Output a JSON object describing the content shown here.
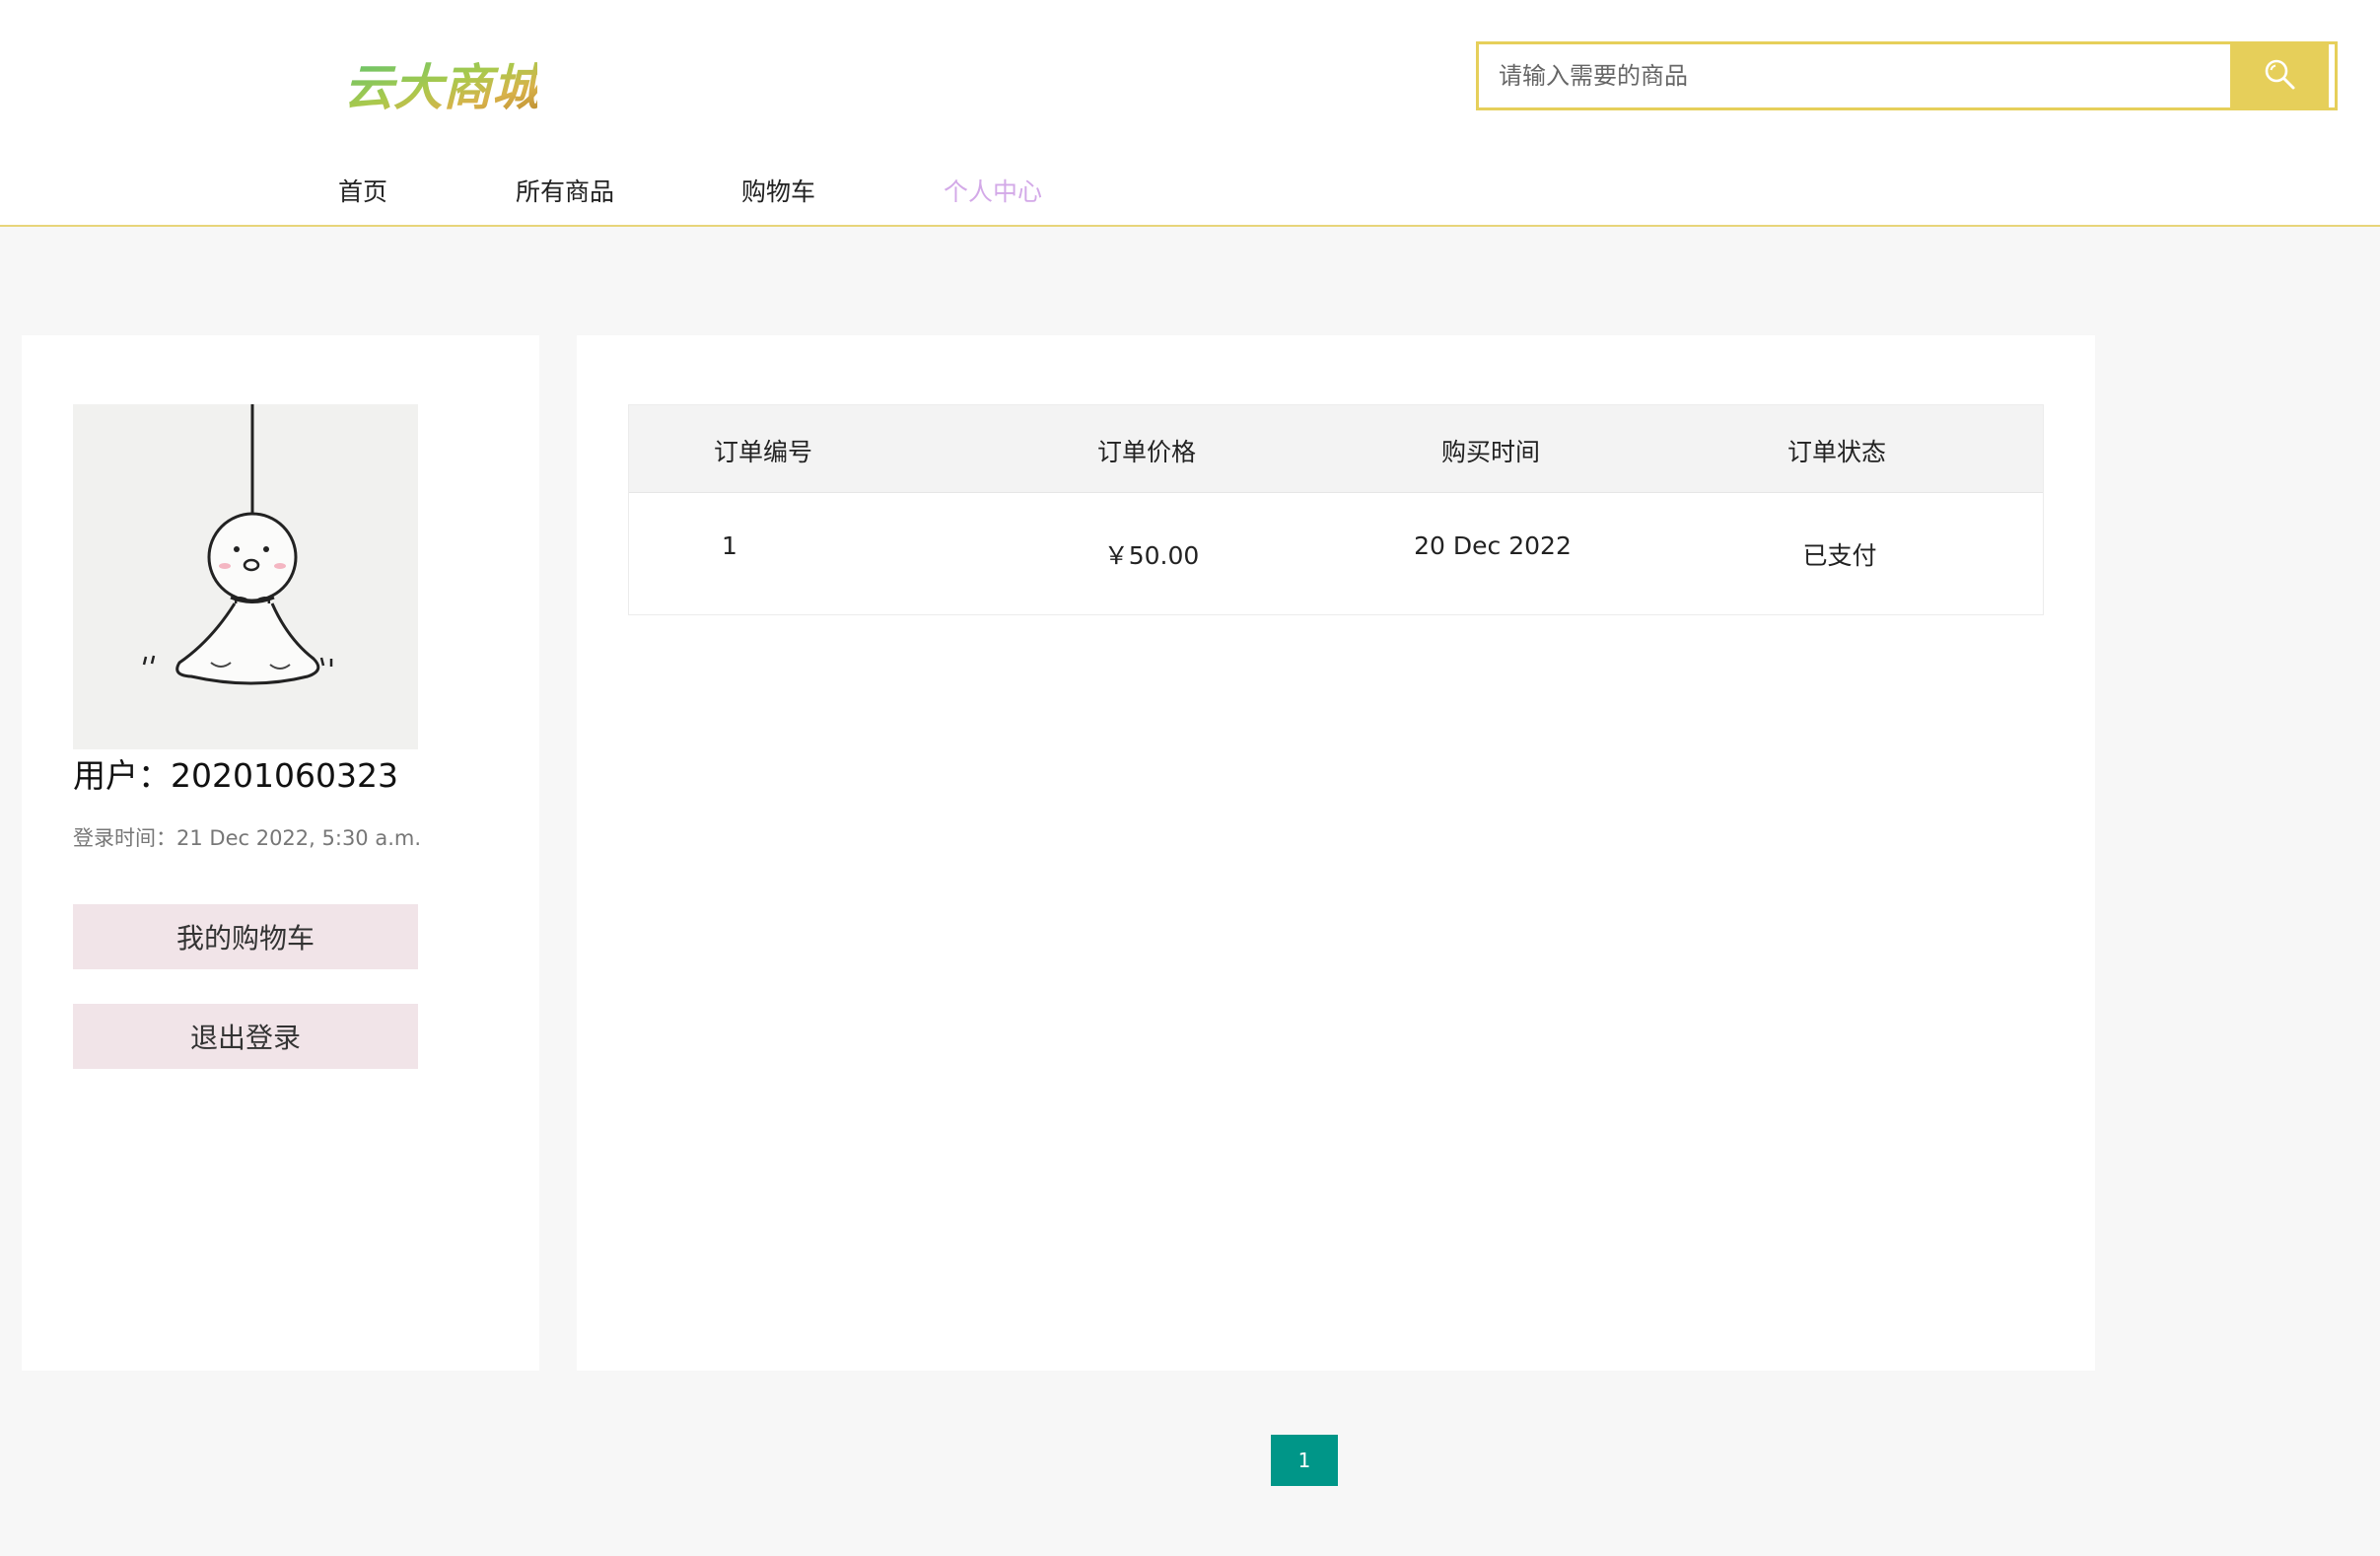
{
  "brand": {
    "logo_text": "云大商城"
  },
  "search": {
    "placeholder": "请输入需要的商品"
  },
  "nav": {
    "items": [
      "首页",
      "所有商品",
      "购物车",
      "个人中心"
    ],
    "active": "个人中心"
  },
  "profile": {
    "username_label": "用户：",
    "username": "20201060323",
    "login_time_label": "登录时间：",
    "login_time": "21 Dec 2022, 5:30 a.m.",
    "cart_button": "我的购物车",
    "logout_button": "退出登录"
  },
  "orders": {
    "headers": [
      "订单编号",
      "订单价格",
      "购买时间",
      "订单状态"
    ],
    "rows": [
      {
        "id": "1",
        "price": "￥50.00",
        "time": "20 Dec 2022",
        "status": "已支付"
      }
    ]
  },
  "pagination": {
    "current": "1"
  },
  "colors": {
    "accent_yellow": "#e6cf5a",
    "nav_active": "#d3a9e8",
    "button_bg": "#f1e4e8",
    "page_active": "#009688"
  }
}
